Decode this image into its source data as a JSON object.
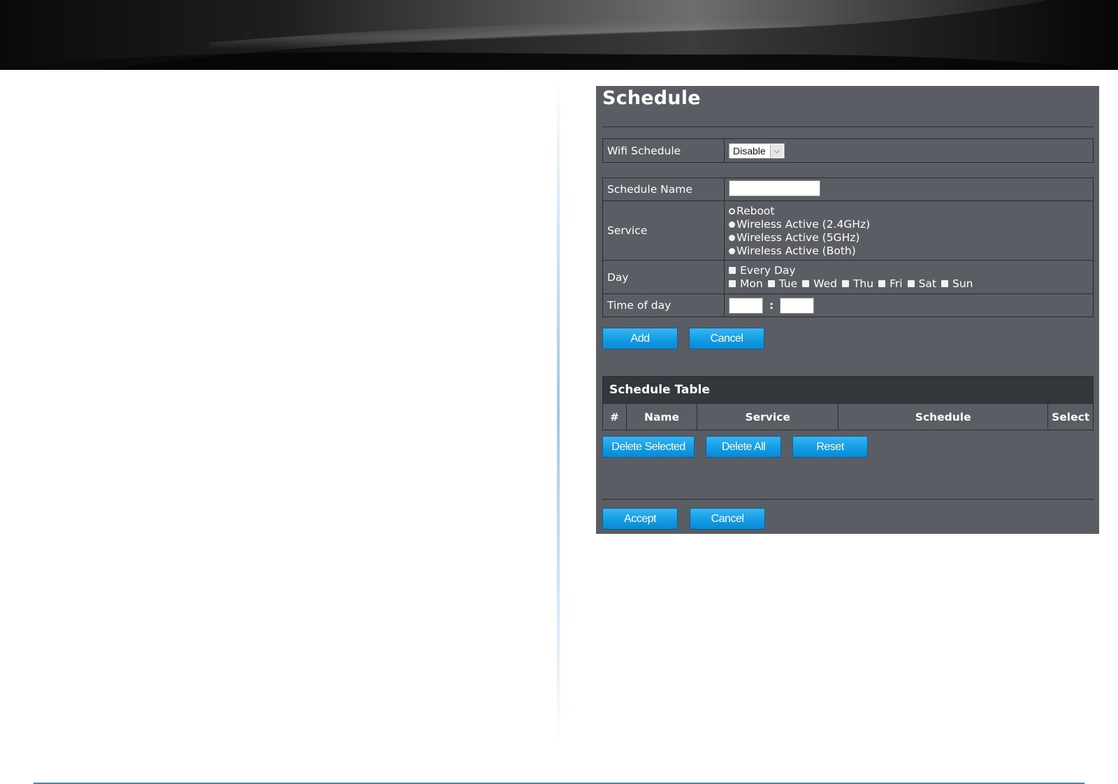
{
  "panel": {
    "title": "Schedule"
  },
  "wifi_schedule": {
    "label": "Wifi Schedule",
    "selected": "Disable"
  },
  "schedule_name": {
    "label": "Schedule Name",
    "value": ""
  },
  "service": {
    "label": "Service",
    "options": [
      "Reboot",
      "Wireless Active (2.4GHz)",
      "Wireless Active (5GHz)",
      "Wireless Active (Both)"
    ]
  },
  "day": {
    "label": "Day",
    "every_day": "Every Day",
    "days": [
      "Mon",
      "Tue",
      "Wed",
      "Thu",
      "Fri",
      "Sat",
      "Sun"
    ]
  },
  "time_of_day": {
    "label": "Time of day",
    "separator": ":",
    "hour": "",
    "minute": ""
  },
  "buttons": {
    "add": "Add",
    "cancel": "Cancel",
    "delete_selected": "Delete Selected",
    "delete_all": "Delete All",
    "reset": "Reset",
    "accept": "Accept",
    "cancel_bottom": "Cancel"
  },
  "schedule_table": {
    "title": "Schedule Table",
    "columns": [
      "#",
      "Name",
      "Service",
      "Schedule",
      "Select"
    ]
  },
  "colors": {
    "panel_bg": "#5a5d63",
    "button_blue": "#159fe6",
    "table_header_bg": "#34373c"
  }
}
